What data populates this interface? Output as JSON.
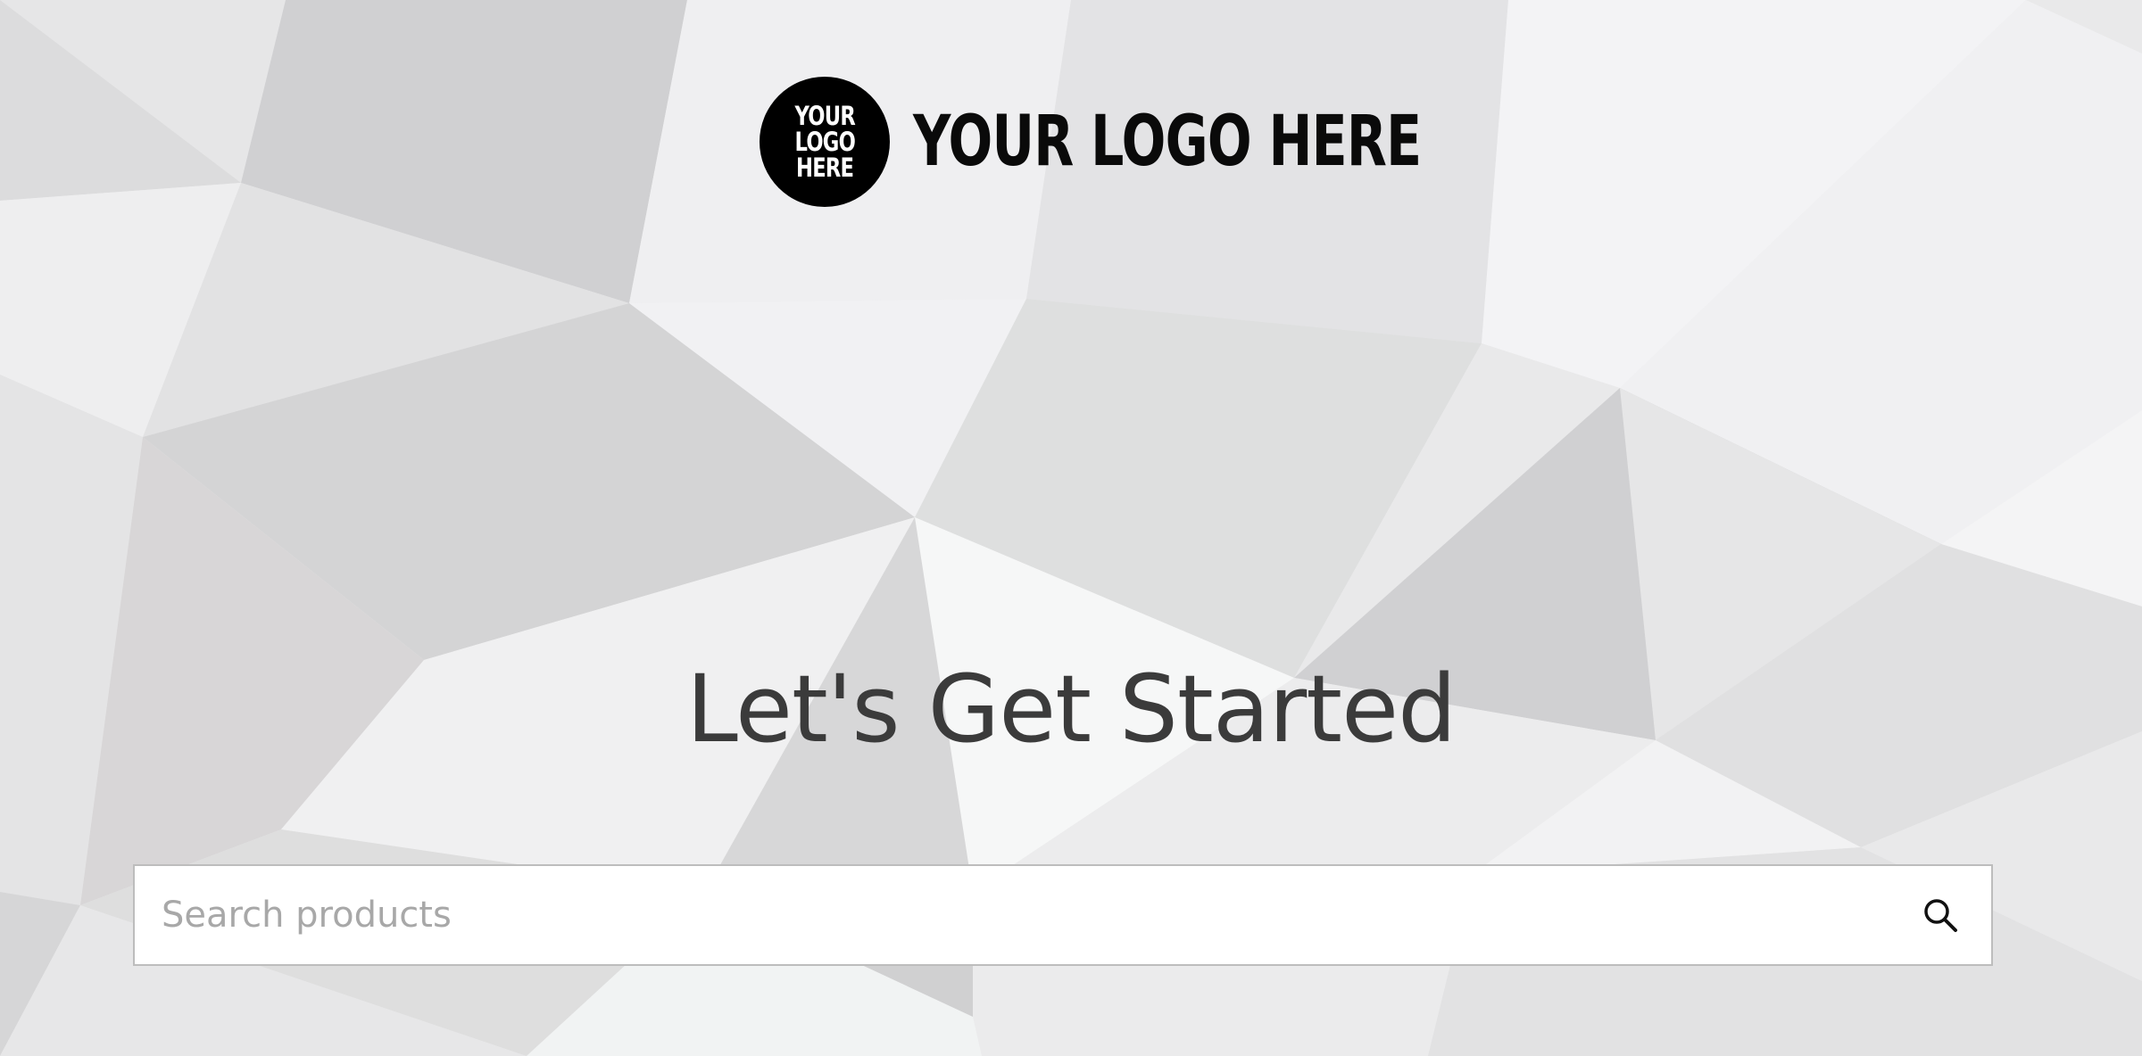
{
  "logo": {
    "mark_lines": [
      "YOUR",
      "LOGO",
      "HERE"
    ],
    "text": "YOUR LOGO HERE"
  },
  "headline": "Let's Get Started",
  "search": {
    "placeholder": "Search products",
    "value": "",
    "icon": "search-icon"
  },
  "colors": {
    "headline": "#3b3b3b",
    "logo": "#000000",
    "search_border": "#bdbdbd",
    "placeholder": "#a8a8a8"
  }
}
